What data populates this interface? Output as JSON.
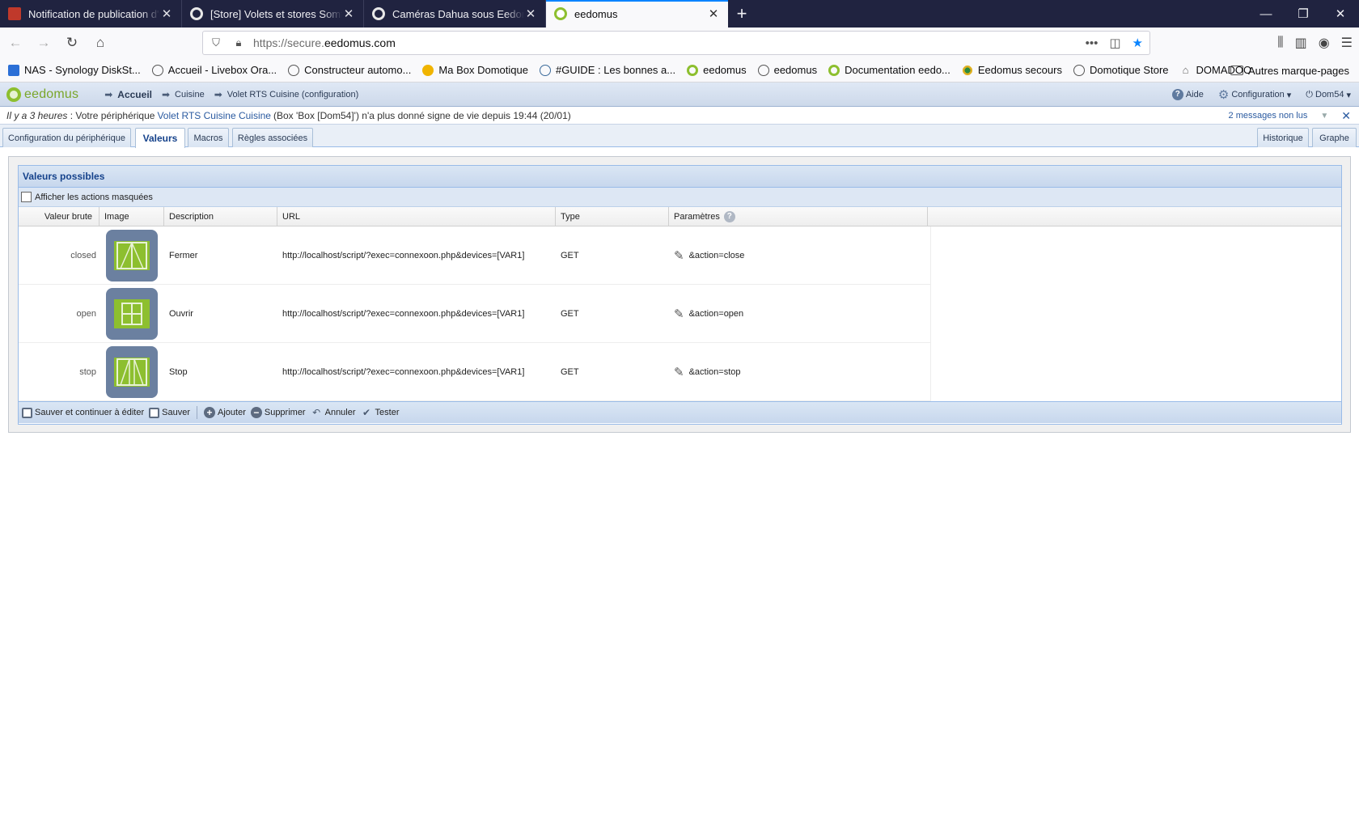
{
  "browser": {
    "tabs": [
      {
        "title": "Notification de publication d'un",
        "active": false
      },
      {
        "title": "[Store] Volets et stores Somfy (RTS)",
        "active": false
      },
      {
        "title": "Caméras Dahua sous Eedomus",
        "active": false
      },
      {
        "title": "eedomus",
        "active": true
      }
    ],
    "new_tab": "+",
    "url_proto": "https://secure.",
    "url_host": "eedomus.com",
    "bookmarks": [
      "NAS - Synology DiskSt...",
      "Accueil - Livebox Ora...",
      "Constructeur automo...",
      "Ma Box Domotique",
      "#GUIDE : Les bonnes a...",
      "eedomus",
      "eedomus",
      "Documentation eedo...",
      "Eedomus secours",
      "Domotique Store",
      "DOMADOO"
    ],
    "bookmarks_other": "Autres marque-pages"
  },
  "app": {
    "logo_text": "eedomus",
    "breadcrumb": [
      "Accueil",
      "Cuisine",
      "Volet RTS Cuisine (configuration)"
    ],
    "header_right": {
      "help": "Aide",
      "config": "Configuration",
      "user": "Dom54"
    },
    "notification": {
      "time": "Il y a 3 heures",
      "prefix": ": Votre périphérique",
      "device": "Volet RTS Cuisine Cuisine",
      "suffix": "(Box 'Box [Dom54]') n'a plus donné signe de vie depuis 19:44 (20/01)",
      "unread": "2 messages non lus"
    },
    "tabs": {
      "config": "Configuration du périphérique",
      "values": "Valeurs",
      "macros": "Macros",
      "rules": "Règles associées",
      "history": "Historique",
      "graph": "Graphe"
    }
  },
  "panel": {
    "title": "Valeurs possibles",
    "show_hidden_label": "Afficher les actions masquées",
    "columns": {
      "raw": "Valeur brute",
      "image": "Image",
      "description": "Description",
      "url": "URL",
      "type": "Type",
      "params": "Paramètres"
    },
    "rows": [
      {
        "raw": "closed",
        "description": "Fermer",
        "url": "http://localhost/script/?exec=connexoon.php&devices=[VAR1]",
        "type": "GET",
        "params": "&action=close",
        "icon": "shutter-closed-icon"
      },
      {
        "raw": "open",
        "description": "Ouvrir",
        "url": "http://localhost/script/?exec=connexoon.php&devices=[VAR1]",
        "type": "GET",
        "params": "&action=open",
        "icon": "window-open-icon"
      },
      {
        "raw": "stop",
        "description": "Stop",
        "url": "http://localhost/script/?exec=connexoon.php&devices=[VAR1]",
        "type": "GET",
        "params": "&action=stop",
        "icon": "shutter-stop-icon"
      }
    ],
    "toolbar": {
      "save_continue": "Sauver et continuer à éditer",
      "save": "Sauver",
      "add": "Ajouter",
      "delete": "Supprimer",
      "cancel": "Annuler",
      "test": "Tester"
    }
  }
}
